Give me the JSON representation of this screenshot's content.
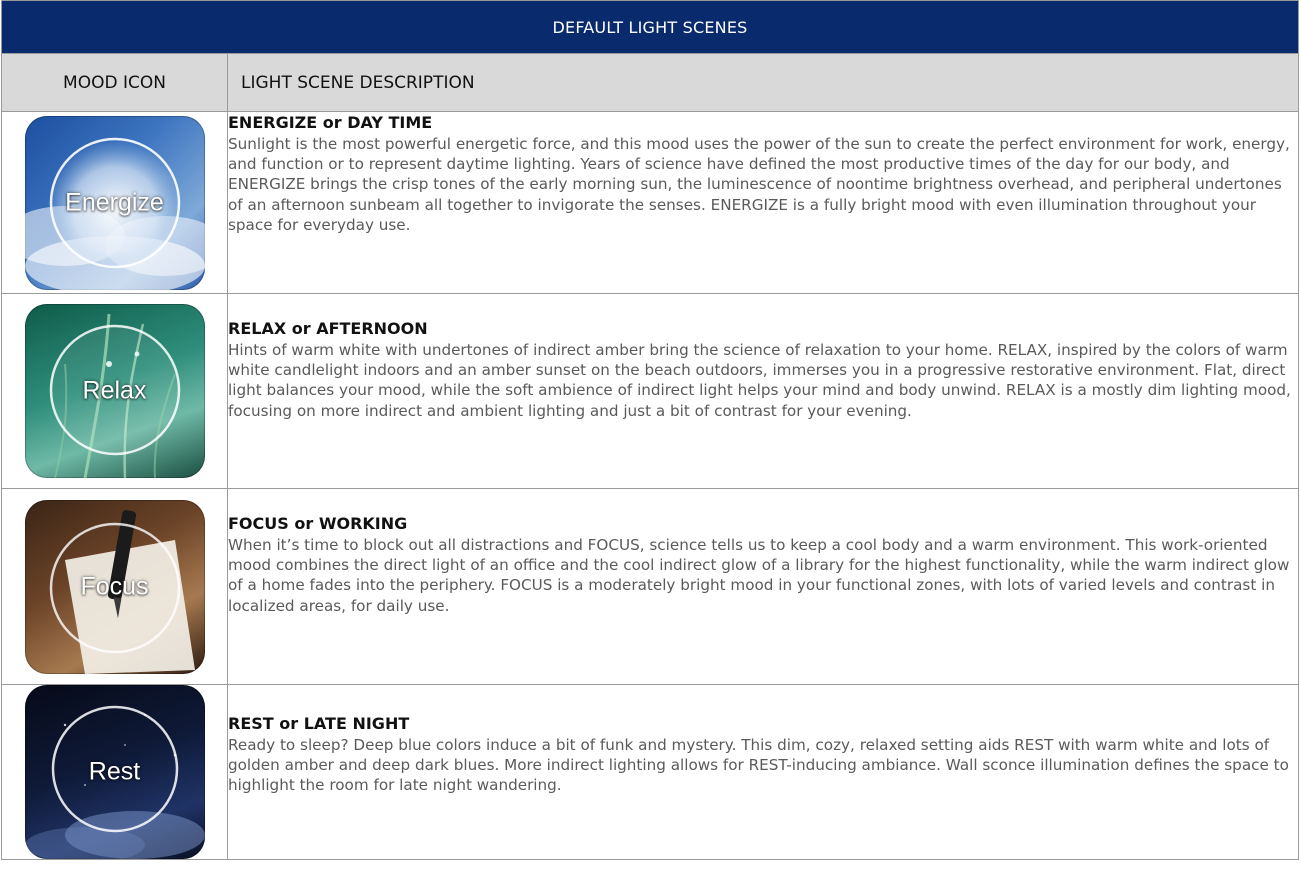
{
  "table": {
    "title": "DEFAULT LIGHT SCENES",
    "headers": {
      "icon": "MOOD ICON",
      "description": "LIGHT SCENE DESCRIPTION"
    }
  },
  "moods": [
    {
      "icon_label": "Energize",
      "icon": "clouds-sky-icon",
      "title": "ENERGIZE or DAY TIME",
      "text": "Sunlight is the most powerful energetic force, and this mood uses the power of the sun to create the perfect environment for work, energy, and function or to represent daytime lighting. Years of science have defined the most productive times of the day for our body, and ENERGIZE brings the crisp tones of the early morning sun, the luminescence of noontime brightness overhead, and peripheral undertones of an afternoon sunbeam all together to invigorate the senses. ENERGIZE is a fully bright mood with even illumination throughout your space for everyday use."
    },
    {
      "icon_label": "Relax",
      "icon": "grass-dew-icon",
      "title": "RELAX or AFTERNOON",
      "text": "Hints of warm white with undertones of indirect amber bring the science of relaxation to your home. RELAX, inspired by the colors of warm white candlelight indoors and an amber sunset on the beach outdoors, immerses you in a progressive restorative environment. Flat, direct light balances your mood, while the soft ambience of indirect light helps your mind and body unwind. RELAX is a mostly dim lighting mood, focusing on more indirect and ambient lighting and just a bit of contrast for your evening."
    },
    {
      "icon_label": "Focus",
      "icon": "pen-paper-icon",
      "title": "FOCUS or WORKING",
      "text": "When it’s time to block out all distractions and FOCUS, science tells us to keep a cool body and a warm environment. This work-oriented mood combines the direct light of an office and the cool indirect glow of a library for the highest functionality, while the warm indirect glow of a home fades into the periphery. FOCUS is a moderately bright mood in your functional zones, with lots of varied levels and contrast in localized areas, for daily use."
    },
    {
      "icon_label": "Rest",
      "icon": "night-sky-icon",
      "title": "REST or LATE NIGHT",
      "text": "Ready to sleep? Deep blue colors induce a bit of funk and mystery. This dim, cozy, relaxed setting aids REST with warm white and lots of golden amber and deep dark blues. More indirect lighting allows for REST-inducing ambiance. Wall sconce illumination defines the space to highlight the room for late night wandering."
    }
  ],
  "colors": {
    "title_bar": "#0a2a6e",
    "header_bar": "#d9d9d9",
    "body_text": "#5a5a5a",
    "border": "#9a9a9a"
  }
}
